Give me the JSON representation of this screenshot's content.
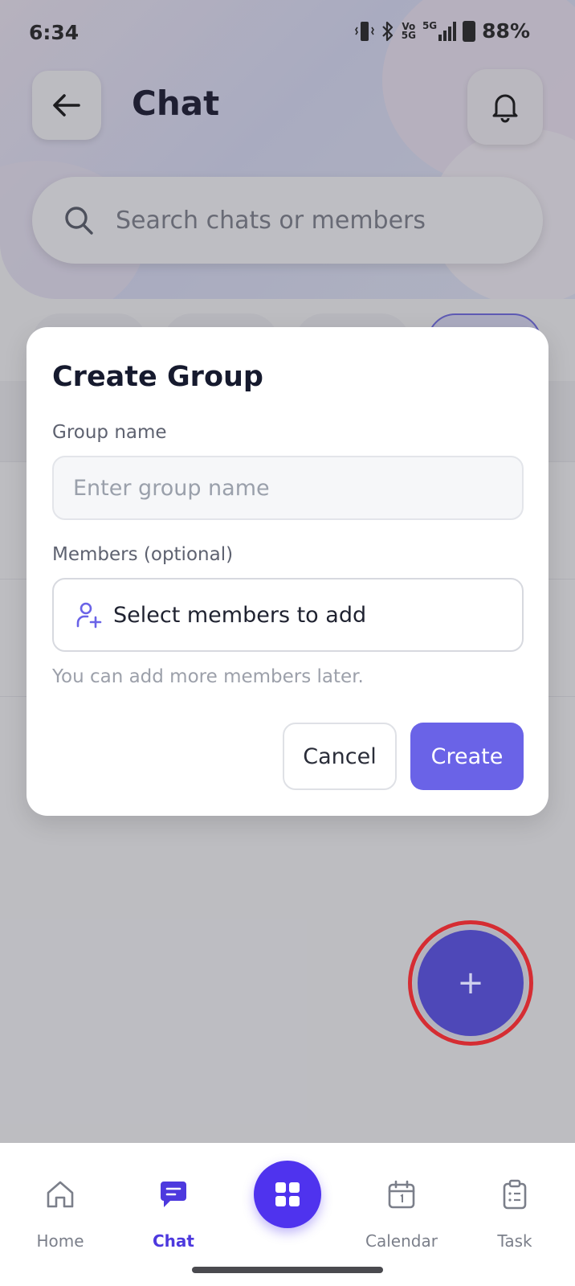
{
  "status_bar": {
    "time": "6:34",
    "network_top": "Vo",
    "network_bottom": "5G",
    "network_5g": "5G",
    "battery": "88%"
  },
  "header": {
    "title": "Chat",
    "back_icon": "arrow-left-icon",
    "bell_icon": "bell-icon"
  },
  "search": {
    "placeholder": "Search chats or members"
  },
  "dialog": {
    "title": "Create Group",
    "group_name_label": "Group name",
    "group_name_placeholder": "Enter group name",
    "members_label": "Members (optional)",
    "members_select": "Select members to add",
    "hint": "You can add more members later.",
    "cancel_label": "Cancel",
    "create_label": "Create"
  },
  "fab": {
    "label": "+"
  },
  "bottom_nav": {
    "items": [
      {
        "label": "Home",
        "icon": "home-icon"
      },
      {
        "label": "Chat",
        "icon": "chat-icon"
      },
      {
        "label": "Calendar",
        "icon": "calendar-icon"
      },
      {
        "label": "Task",
        "icon": "clipboard-icon"
      }
    ],
    "center_icon": "grid-icon"
  },
  "colors": {
    "accent": "#6a63e7",
    "nav_active": "#4d39de",
    "fab": "#4e48b8",
    "highlight_ring": "#d52d33"
  }
}
